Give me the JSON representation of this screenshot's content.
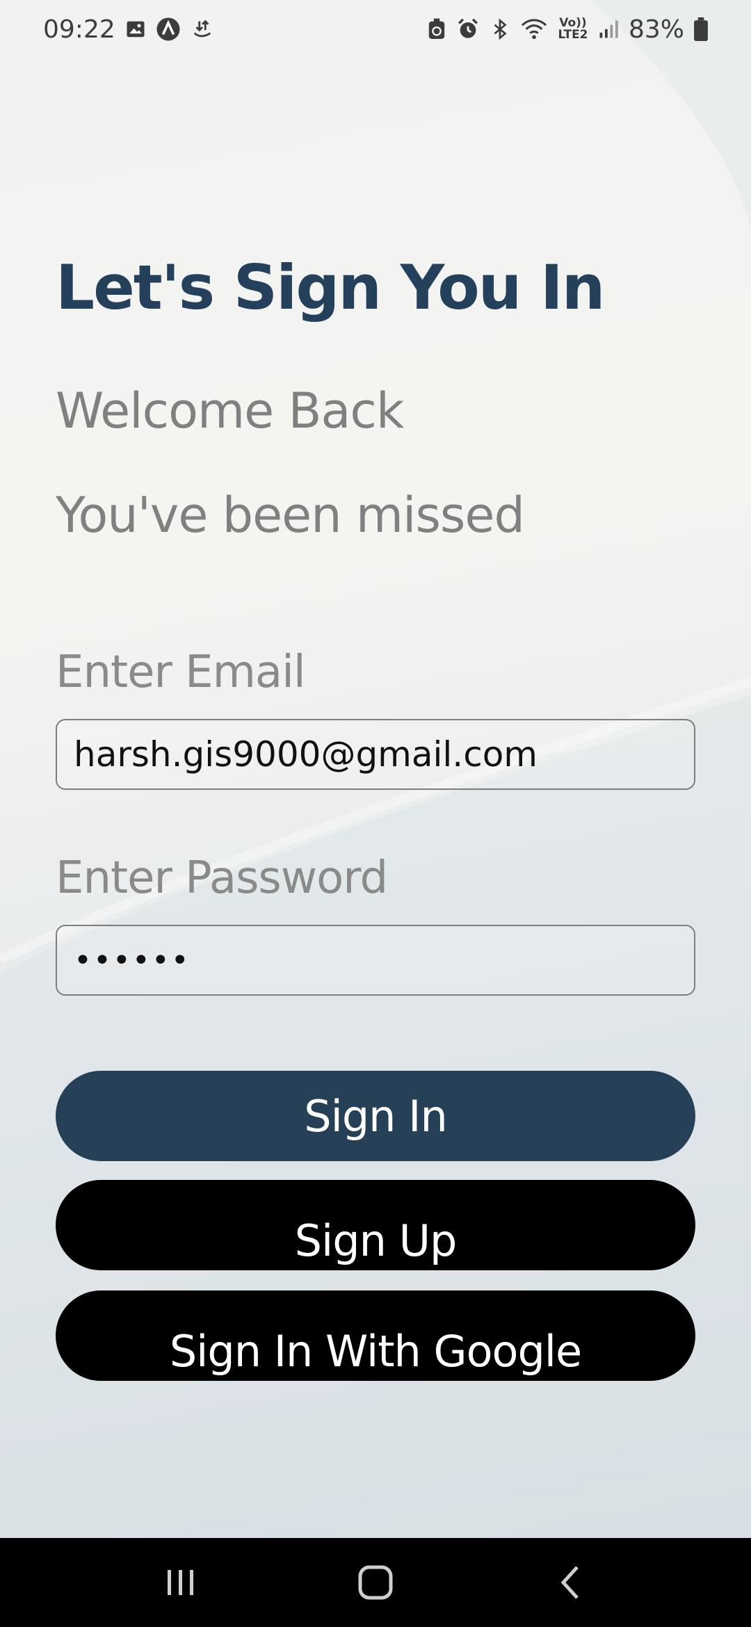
{
  "status_bar": {
    "time": "09:22",
    "battery": "83%",
    "network_label": "Vo)) LTE2",
    "icons_left": [
      "gallery-icon",
      "app-a-icon",
      "transfer-icon"
    ],
    "icons_right": [
      "recycle-icon",
      "alarm-icon",
      "bluetooth-icon",
      "wifi-icon",
      "signal-icon",
      "battery-icon"
    ]
  },
  "header": {
    "title": "Let's Sign You In",
    "subtitle_1": "Welcome Back",
    "subtitle_2": "You've been missed"
  },
  "form": {
    "email_label": "Enter Email",
    "email_value": "harsh.gis9000@gmail.com",
    "password_label": "Enter Password",
    "password_value": "••••••"
  },
  "buttons": {
    "sign_in": "Sign In",
    "sign_up": "Sign Up",
    "google": "Sign In With Google"
  },
  "colors": {
    "primary": "#254057",
    "title": "#24405a",
    "secondary_button": "#000000",
    "muted_text": "#808080"
  },
  "nav_bar": {
    "icons": [
      "recents-icon",
      "home-icon",
      "back-icon"
    ]
  }
}
